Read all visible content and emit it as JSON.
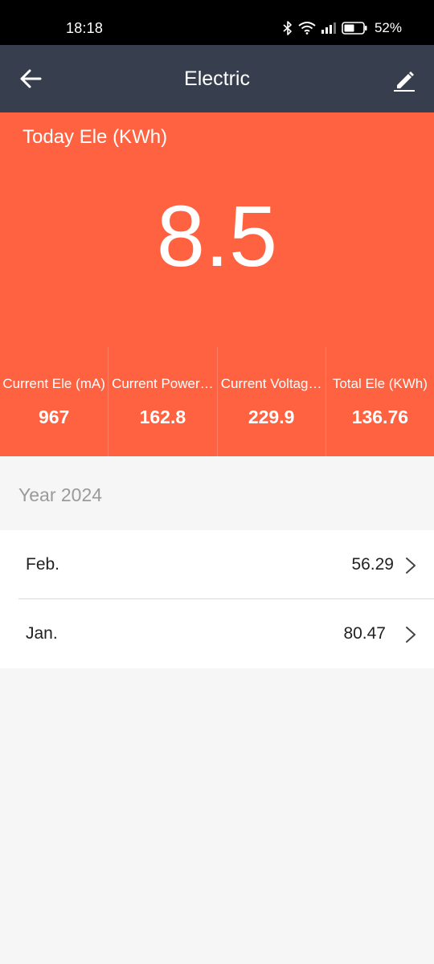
{
  "status_bar": {
    "time": "18:18",
    "battery_percent": "52%"
  },
  "app_bar": {
    "title": "Electric",
    "back_icon": "arrow-left-icon",
    "edit_icon": "pencil-icon"
  },
  "hero": {
    "label": "Today Ele (KWh)",
    "value": "8.5"
  },
  "stats": [
    {
      "label": "Current Ele (mA)",
      "value": "967"
    },
    {
      "label": "Current Power…",
      "value": "162.8"
    },
    {
      "label": "Current Voltag…",
      "value": "229.9"
    },
    {
      "label": "Total Ele (KWh)",
      "value": "136.76"
    }
  ],
  "year_header": "Year 2024",
  "months": [
    {
      "name": "Feb.",
      "value": "56.29"
    },
    {
      "name": "Jan.",
      "value": "80.47"
    }
  ],
  "colors": {
    "accent": "#ff6240",
    "app_bar": "#373e4e",
    "background": "#f6f6f6"
  }
}
